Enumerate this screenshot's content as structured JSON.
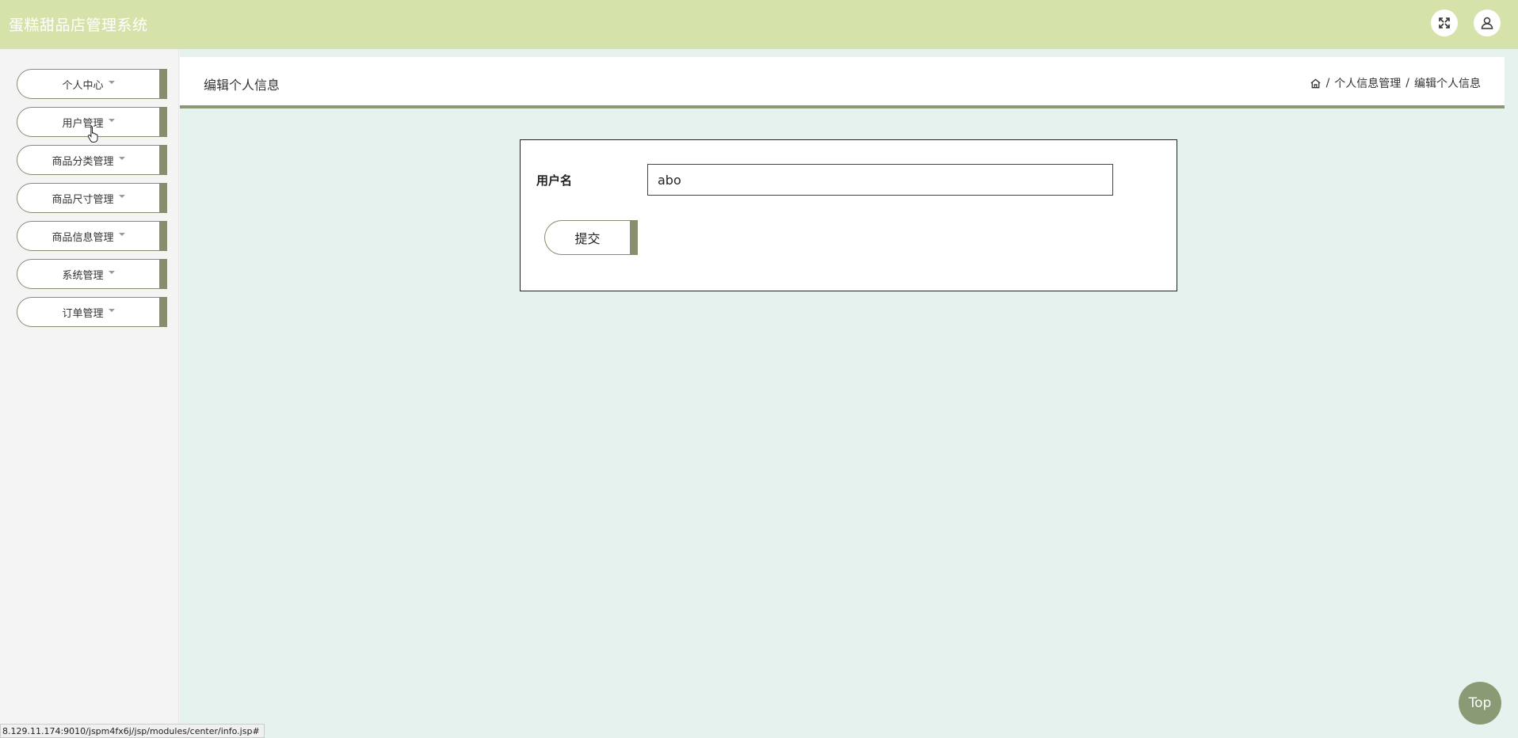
{
  "app": {
    "title": "蛋糕甜品店管理系统"
  },
  "header_icons": [
    {
      "name": "fullscreen-icon"
    },
    {
      "name": "user-icon"
    }
  ],
  "sidebar": {
    "items": [
      {
        "label": "个人中心"
      },
      {
        "label": "用户管理"
      },
      {
        "label": "商品分类管理"
      },
      {
        "label": "商品尺寸管理"
      },
      {
        "label": "商品信息管理"
      },
      {
        "label": "系统管理"
      },
      {
        "label": "订单管理"
      }
    ]
  },
  "page": {
    "title": "编辑个人信息",
    "breadcrumb": {
      "home_icon": "home-icon",
      "sep1": "/",
      "level1": "个人信息管理",
      "sep2": "/",
      "level2": "编辑个人信息"
    }
  },
  "form": {
    "username_label": "用户名",
    "username_value": "abo",
    "submit_label": "提交"
  },
  "back_to_top": "Top",
  "status_url": "8.129.11.174:9010/jspm4fx6j/jsp/modules/center/info.jsp#",
  "colors": {
    "topbar": "#d5e3aa",
    "accent": "#888d6e",
    "main_bg": "#e6f2ed"
  }
}
